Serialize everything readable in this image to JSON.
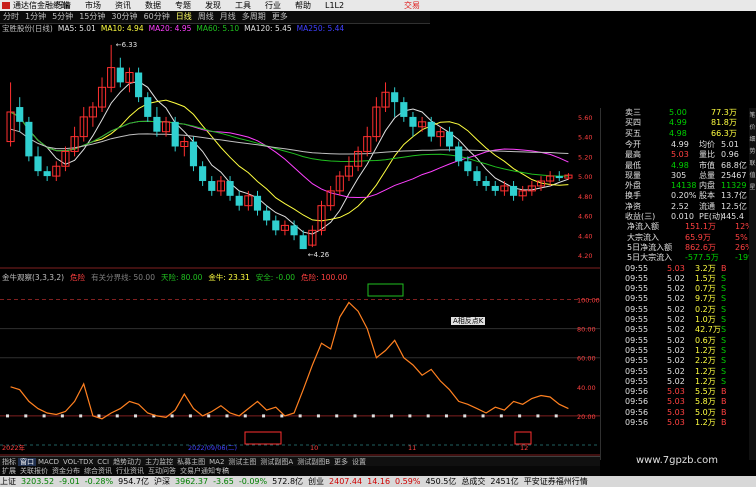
{
  "window": {
    "title": "通达信金融终端",
    "trade_label": "交易"
  },
  "menu": [
    "行情",
    "市场",
    "资讯",
    "数据",
    "专题",
    "发现",
    "工具",
    "行业",
    "帮助",
    "L1L2"
  ],
  "periods": [
    {
      "label": "分时",
      "sel": false
    },
    {
      "label": "1分钟",
      "sel": false
    },
    {
      "label": "5分钟",
      "sel": false
    },
    {
      "label": "15分钟",
      "sel": false
    },
    {
      "label": "30分钟",
      "sel": false
    },
    {
      "label": "60分钟",
      "sel": false
    },
    {
      "label": "日线",
      "sel": true
    },
    {
      "label": "周线",
      "sel": false
    },
    {
      "label": "月线",
      "sel": false
    },
    {
      "label": "多周期",
      "sel": false
    },
    {
      "label": "更多",
      "sel": false
    }
  ],
  "ma_legend": [
    {
      "text": "宝胜股份(日线)",
      "color": "#c0c0c0"
    },
    {
      "text": "MA5: 5.01",
      "color": "#e0e0e0"
    },
    {
      "text": "MA10: 4.94",
      "color": "#ffff40"
    },
    {
      "text": "MA20: 4.95",
      "color": "#ff40ff"
    },
    {
      "text": "MA60: 5.10",
      "color": "#20c020"
    },
    {
      "text": "MA120: 5.45",
      "color": "#e0e0e0"
    },
    {
      "text": "MA250: 5.44",
      "color": "#4040ff"
    }
  ],
  "ind_legend": [
    {
      "text": "金牛观察(3,3,3,2)",
      "color": "#c0c0c0"
    },
    {
      "text": "危险",
      "color": "#ff4040"
    },
    {
      "text": "有关分界线: 50.00",
      "color": "#808080"
    },
    {
      "text": "天险: 80.00",
      "color": "#20c020"
    },
    {
      "text": "金牛: 23.31",
      "color": "#ffff40"
    },
    {
      "text": "安全: -0.00",
      "color": "#20c020"
    },
    {
      "text": "危险: 100.00",
      "color": "#ff4040"
    }
  ],
  "chart_data": {
    "type": "candlestick",
    "price_axis": {
      "ticks": [
        "5.60",
        "5.40",
        "5.20",
        "5.00",
        "4.80",
        "4.60",
        "4.40",
        "4.20"
      ]
    },
    "osc_axis": {
      "ticks": [
        "100.00",
        "80.00",
        "60.00",
        "40.00",
        "20.00"
      ],
      "labels_right": [
        "危险",
        "",
        "",
        "",
        "危险"
      ]
    },
    "annotations": {
      "high": "6.33",
      "low": "4.26"
    },
    "candles": [
      [
        5.35,
        5.65,
        5.95,
        5.3
      ],
      [
        5.7,
        5.55,
        5.8,
        5.45
      ],
      [
        5.55,
        5.2,
        5.6,
        5.15
      ],
      [
        5.2,
        5.05,
        5.3,
        5.0
      ],
      [
        5.05,
        5.0,
        5.1,
        4.95
      ],
      [
        5.0,
        5.1,
        5.15,
        4.95
      ],
      [
        5.1,
        5.25,
        5.3,
        5.05
      ],
      [
        5.25,
        5.4,
        5.5,
        5.2
      ],
      [
        5.4,
        5.6,
        5.7,
        5.35
      ],
      [
        5.6,
        5.7,
        5.75,
        5.5
      ],
      [
        5.7,
        5.9,
        6.0,
        5.65
      ],
      [
        5.9,
        6.1,
        6.33,
        5.85
      ],
      [
        6.1,
        5.95,
        6.2,
        5.9
      ],
      [
        5.95,
        6.05,
        6.1,
        5.85
      ],
      [
        6.05,
        5.8,
        6.1,
        5.75
      ],
      [
        5.8,
        5.6,
        5.85,
        5.55
      ],
      [
        5.6,
        5.45,
        5.7,
        5.4
      ],
      [
        5.45,
        5.55,
        5.6,
        5.4
      ],
      [
        5.55,
        5.3,
        5.6,
        5.25
      ],
      [
        5.3,
        5.35,
        5.4,
        5.2
      ],
      [
        5.35,
        5.1,
        5.4,
        5.05
      ],
      [
        5.1,
        4.95,
        5.15,
        4.9
      ],
      [
        4.95,
        4.85,
        5.0,
        4.8
      ],
      [
        4.85,
        4.95,
        5.0,
        4.8
      ],
      [
        4.95,
        4.8,
        5.0,
        4.75
      ],
      [
        4.8,
        4.7,
        4.85,
        4.65
      ],
      [
        4.7,
        4.8,
        4.85,
        4.65
      ],
      [
        4.8,
        4.65,
        4.85,
        4.6
      ],
      [
        4.65,
        4.55,
        4.7,
        4.5
      ],
      [
        4.55,
        4.45,
        4.6,
        4.4
      ],
      [
        4.45,
        4.5,
        4.55,
        4.4
      ],
      [
        4.5,
        4.4,
        4.55,
        4.35
      ],
      [
        4.4,
        4.26,
        4.45,
        4.26
      ],
      [
        4.3,
        4.45,
        4.5,
        4.28
      ],
      [
        4.45,
        4.7,
        4.75,
        4.4
      ],
      [
        4.7,
        4.85,
        4.9,
        4.65
      ],
      [
        4.85,
        5.0,
        5.05,
        4.8
      ],
      [
        5.0,
        5.1,
        5.2,
        4.95
      ],
      [
        5.1,
        5.25,
        5.3,
        5.05
      ],
      [
        5.25,
        5.4,
        5.5,
        5.2
      ],
      [
        5.4,
        5.7,
        5.8,
        5.35
      ],
      [
        5.7,
        5.85,
        5.95,
        5.65
      ],
      [
        5.85,
        5.75,
        5.9,
        5.6
      ],
      [
        5.75,
        5.6,
        5.8,
        5.55
      ],
      [
        5.6,
        5.5,
        5.65,
        5.4
      ],
      [
        5.5,
        5.55,
        5.6,
        5.45
      ],
      [
        5.55,
        5.4,
        5.6,
        5.35
      ],
      [
        5.4,
        5.45,
        5.5,
        5.3
      ],
      [
        5.45,
        5.3,
        5.5,
        5.25
      ],
      [
        5.3,
        5.15,
        5.35,
        5.1
      ],
      [
        5.15,
        5.05,
        5.2,
        5.0
      ],
      [
        5.05,
        4.95,
        5.1,
        4.9
      ],
      [
        4.95,
        4.9,
        5.0,
        4.85
      ],
      [
        4.9,
        4.85,
        4.95,
        4.8
      ],
      [
        4.85,
        4.9,
        4.95,
        4.8
      ],
      [
        4.9,
        4.8,
        4.95,
        4.75
      ],
      [
        4.8,
        4.85,
        4.9,
        4.75
      ],
      [
        4.85,
        4.9,
        4.95,
        4.8
      ],
      [
        4.9,
        4.95,
        5.0,
        4.85
      ],
      [
        4.95,
        5.0,
        5.05,
        4.9
      ],
      [
        5.0,
        4.98,
        5.05,
        4.95
      ],
      [
        4.98,
        5.01,
        5.03,
        4.96
      ]
    ],
    "oscillator": [
      40,
      38,
      30,
      25,
      22,
      21,
      23,
      30,
      42,
      20,
      18,
      22,
      25,
      30,
      28,
      22,
      20,
      19,
      24,
      35,
      25,
      20,
      23,
      27,
      22,
      20,
      25,
      30,
      24,
      26,
      20,
      22,
      38,
      55,
      70,
      66,
      88,
      98,
      92,
      80,
      60,
      65,
      72,
      60,
      55,
      48,
      52,
      44,
      38,
      30,
      28,
      25,
      22,
      26,
      24,
      30,
      28,
      32,
      34,
      33,
      28,
      25
    ],
    "date_markers": [
      "2022年",
      "2022/09/06(二)",
      "10",
      "11",
      "12"
    ]
  },
  "quote": {
    "asks": [
      {
        "label": "卖三",
        "price": "5.00",
        "vol": "77.3万"
      },
      {
        "label": "买四",
        "price": "4.99",
        "vol": "81.8万"
      },
      {
        "label": "买五",
        "price": "4.98",
        "vol": "66.3万"
      }
    ],
    "stats": [
      [
        "今开",
        "4.99",
        "均价",
        "5.01"
      ],
      [
        "最高",
        "5.03",
        "量比",
        "0.96"
      ],
      [
        "最低",
        "4.98",
        "市值",
        "68.8亿"
      ],
      [
        "现量",
        "305",
        "总量",
        "25467"
      ],
      [
        "外盘",
        "14138",
        "内盘",
        "11329"
      ],
      [
        "换手",
        "0.20%",
        "股本",
        "13.7亿"
      ],
      [
        "净资",
        "2.52",
        "流通",
        "12.5亿"
      ],
      [
        "收益(三)",
        "0.010",
        "PE(动)",
        "445.4"
      ]
    ],
    "flows": [
      {
        "label": "净流入额",
        "value": "151.1万",
        "pct": "12%"
      },
      {
        "label": "大宗流入",
        "value": "65.9万",
        "pct": "5%"
      },
      {
        "label": "5日净流入额",
        "value": "862.6万",
        "pct": "26%"
      },
      {
        "label": "5日大宗流入",
        "value": "-577.5万",
        "pct": "-19%"
      }
    ],
    "ticks": [
      [
        "09:55",
        "5.03",
        "3.2万",
        "B"
      ],
      [
        "09:55",
        "5.02",
        "1.5万",
        "S"
      ],
      [
        "09:55",
        "5.02",
        "0.7万",
        "S"
      ],
      [
        "09:55",
        "5.02",
        "9.7万",
        "S"
      ],
      [
        "09:55",
        "5.02",
        "0.2万",
        "S"
      ],
      [
        "09:55",
        "5.02",
        "1.0万",
        "S"
      ],
      [
        "09:55",
        "5.02",
        "42.7万",
        "S"
      ],
      [
        "09:55",
        "5.02",
        "0.6万",
        "S"
      ],
      [
        "09:55",
        "5.02",
        "1.2万",
        "S"
      ],
      [
        "09:55",
        "5.02",
        "2.2万",
        "S"
      ],
      [
        "09:55",
        "5.02",
        "1.2万",
        "S"
      ],
      [
        "09:55",
        "5.02",
        "1.2万",
        "S"
      ],
      [
        "09:56",
        "5.03",
        "5.5万",
        "B"
      ],
      [
        "09:56",
        "5.03",
        "5.8万",
        "B"
      ],
      [
        "09:56",
        "5.03",
        "5.0万",
        "B"
      ],
      [
        "09:56",
        "5.03",
        "1.2万",
        "B"
      ]
    ]
  },
  "bottom_tabs": [
    "指标",
    "窗口",
    "MACD",
    "VOL-TDX",
    "CCI",
    "趋势动力",
    "主力监控",
    "私募主图",
    "MA2",
    "测试主图",
    "测试副图A",
    "测试副图B",
    "更多",
    "设置"
  ],
  "bottom_tabs2": [
    "扩展",
    "关联报价",
    "资金分布",
    "综合资讯",
    "行业资讯",
    "互动问答",
    "交易户通知专稿"
  ],
  "side_tabs": [
    "笔",
    "价",
    "细",
    "势",
    "联",
    "值",
    "星"
  ],
  "status": {
    "items": [
      {
        "label": "上证",
        "value": "3203.52",
        "chg": "-9.01",
        "pct": "-0.28%",
        "vol": "954.7亿",
        "cls": "dn"
      },
      {
        "label": "沪深",
        "value": "3962.37",
        "chg": "-3.65",
        "pct": "-0.09%",
        "vol": "572.8亿",
        "cls": "dn"
      },
      {
        "label": "创业",
        "value": "2407.44",
        "chg": "14.16",
        "pct": "0.59%",
        "vol": "450.5亿",
        "cls": "up"
      },
      {
        "label": "总成交",
        "value": "2451亿",
        "chg": "",
        "pct": "",
        "vol": "",
        "cls": "wh"
      }
    ],
    "broker": "平安证券福州行情"
  },
  "watermark": "www.7gpzb.com",
  "popup": "A相反点K"
}
